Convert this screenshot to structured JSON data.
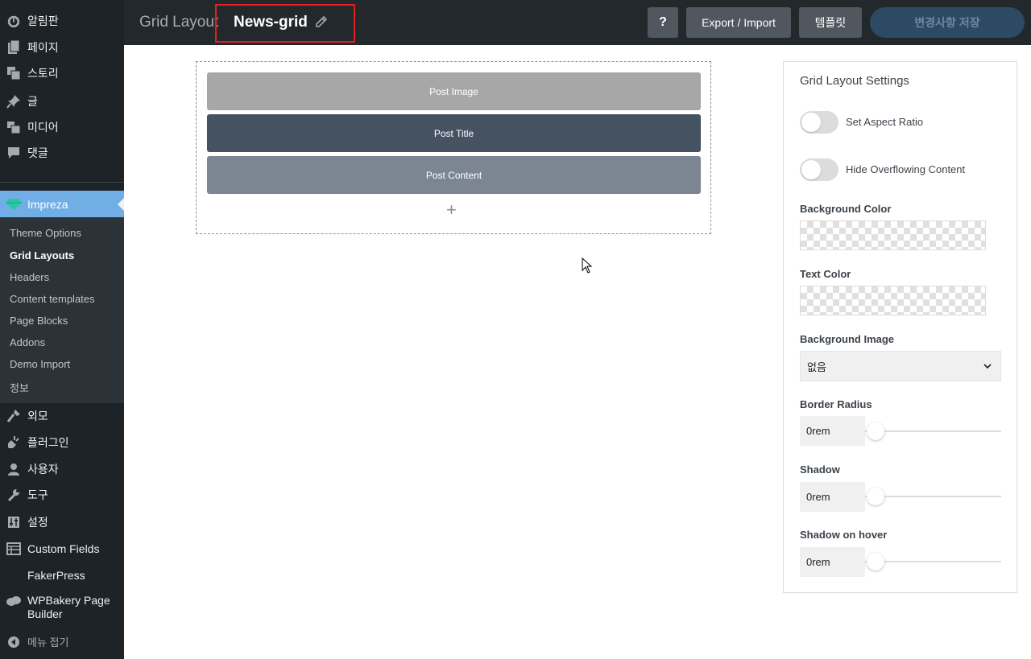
{
  "sidebar": {
    "menu_top": [
      {
        "label": "알림판",
        "icon": "dashboard-icon"
      },
      {
        "label": "페이지",
        "icon": "pages-icon"
      },
      {
        "label": "스토리",
        "icon": "stories-icon"
      },
      {
        "label": "글",
        "icon": "pin-icon"
      },
      {
        "label": "미디어",
        "icon": "media-icon"
      },
      {
        "label": "댓글",
        "icon": "comments-icon"
      }
    ],
    "impreza": {
      "label": "Impreza",
      "icon": "impreza-gem-icon"
    },
    "submenu": [
      {
        "label": "Theme Options"
      },
      {
        "label": "Grid Layouts",
        "active": true
      },
      {
        "label": "Headers"
      },
      {
        "label": "Content templates"
      },
      {
        "label": "Page Blocks"
      },
      {
        "label": "Addons"
      },
      {
        "label": "Demo Import"
      },
      {
        "label": "정보"
      }
    ],
    "menu_bottom": [
      {
        "label": "외모",
        "icon": "appearance-icon"
      },
      {
        "label": "플러그인",
        "icon": "plugins-icon"
      },
      {
        "label": "사용자",
        "icon": "users-icon"
      },
      {
        "label": "도구",
        "icon": "tools-icon"
      },
      {
        "label": "설정",
        "icon": "settings-icon"
      },
      {
        "label": "Custom Fields",
        "icon": "custom-fields-icon"
      },
      {
        "label": "FakerPress",
        "icon": ""
      },
      {
        "label": "WPBakery Page",
        "label2": "Builder",
        "icon": "wpbakery-icon"
      },
      {
        "label": "메뉴 접기",
        "icon": "collapse-icon"
      }
    ]
  },
  "topbar": {
    "section_title": "Grid Layout",
    "layout_name": "News-grid",
    "help_label": "?",
    "export_label": "Export / Import",
    "templates_label": "템플릿",
    "save_label": "변경사항 저장"
  },
  "canvas": {
    "blocks": [
      {
        "label": "Post Image"
      },
      {
        "label": "Post Title"
      },
      {
        "label": "Post Content"
      }
    ],
    "add_label": "+"
  },
  "settings": {
    "title": "Grid Layout Settings",
    "aspect_ratio_label": "Set Aspect Ratio",
    "aspect_ratio_on": false,
    "overflow_label": "Hide Overflowing Content",
    "overflow_on": false,
    "bg_color_label": "Background Color",
    "text_color_label": "Text Color",
    "bg_image_label": "Background Image",
    "bg_image_value": "없음",
    "border_radius_label": "Border Radius",
    "border_radius_value": "0rem",
    "shadow_label": "Shadow",
    "shadow_value": "0rem",
    "shadow_hover_label": "Shadow on hover",
    "shadow_hover_value": "0rem"
  },
  "colors": {
    "sidebar_bg": "#1d2327",
    "accent": "#72aee6",
    "topbar_bg": "#23282d",
    "highlight": "#e02020"
  }
}
